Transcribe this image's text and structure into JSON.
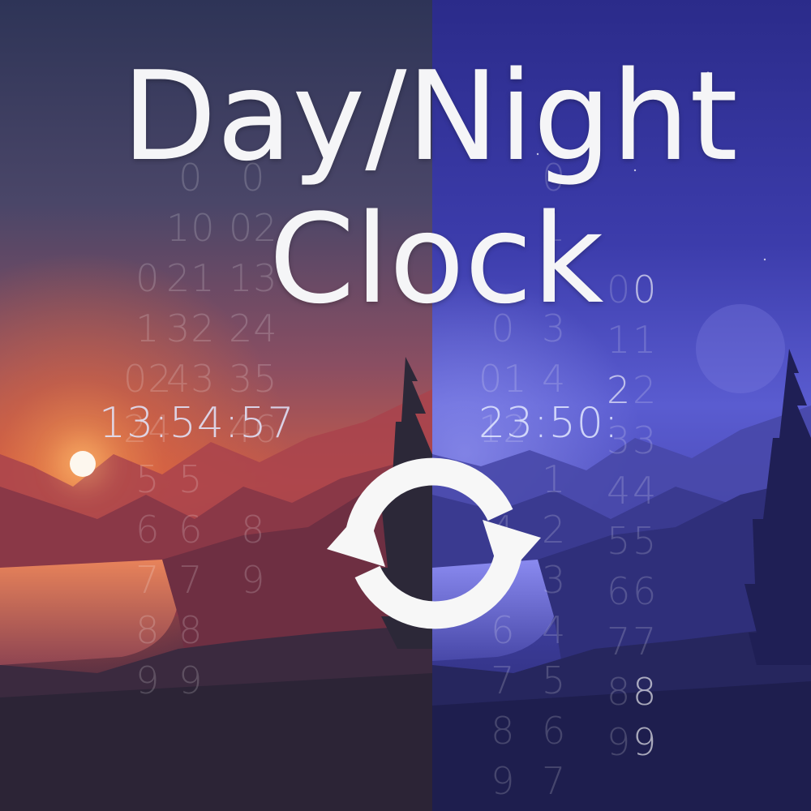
{
  "title": {
    "line1": "Day/Night",
    "line2": "Clock"
  },
  "day": {
    "time": "13:54:57",
    "colors": {
      "sky_top": "#2e3457",
      "sky_glow": "#e0643a",
      "sun": "#fdf7ee"
    }
  },
  "night": {
    "time": "23:50:",
    "colors": {
      "sky_top": "#2b2b8a",
      "sky_glow": "#6c6ee0"
    }
  },
  "digit_columns": {
    "day": [
      [
        "0",
        "1",
        "02",
        "24",
        "5",
        "6",
        "7",
        "8",
        "9"
      ],
      [
        "0",
        "10",
        "21",
        "32",
        "43",
        "5",
        "6",
        "7",
        "8",
        "9"
      ],
      [
        "0",
        "02",
        "13",
        "24",
        "35",
        "46",
        "8",
        "9"
      ]
    ],
    "night": [
      [
        "0",
        "01",
        "12",
        "4",
        "5",
        "6",
        "7",
        "8",
        "9"
      ],
      [
        "0",
        "1",
        "3",
        "4",
        "1",
        "2",
        "3",
        "4",
        "5",
        "6",
        "7"
      ],
      [
        "0",
        "1",
        "2",
        "3",
        "4",
        "5",
        "6",
        "7",
        "8",
        "9"
      ],
      [
        "0",
        "1",
        "2",
        "3",
        "4",
        "5",
        "6",
        "7",
        "8",
        "9"
      ]
    ]
  },
  "icons": {
    "toggle": "refresh-cycle-icon",
    "sun": "sun-icon"
  }
}
